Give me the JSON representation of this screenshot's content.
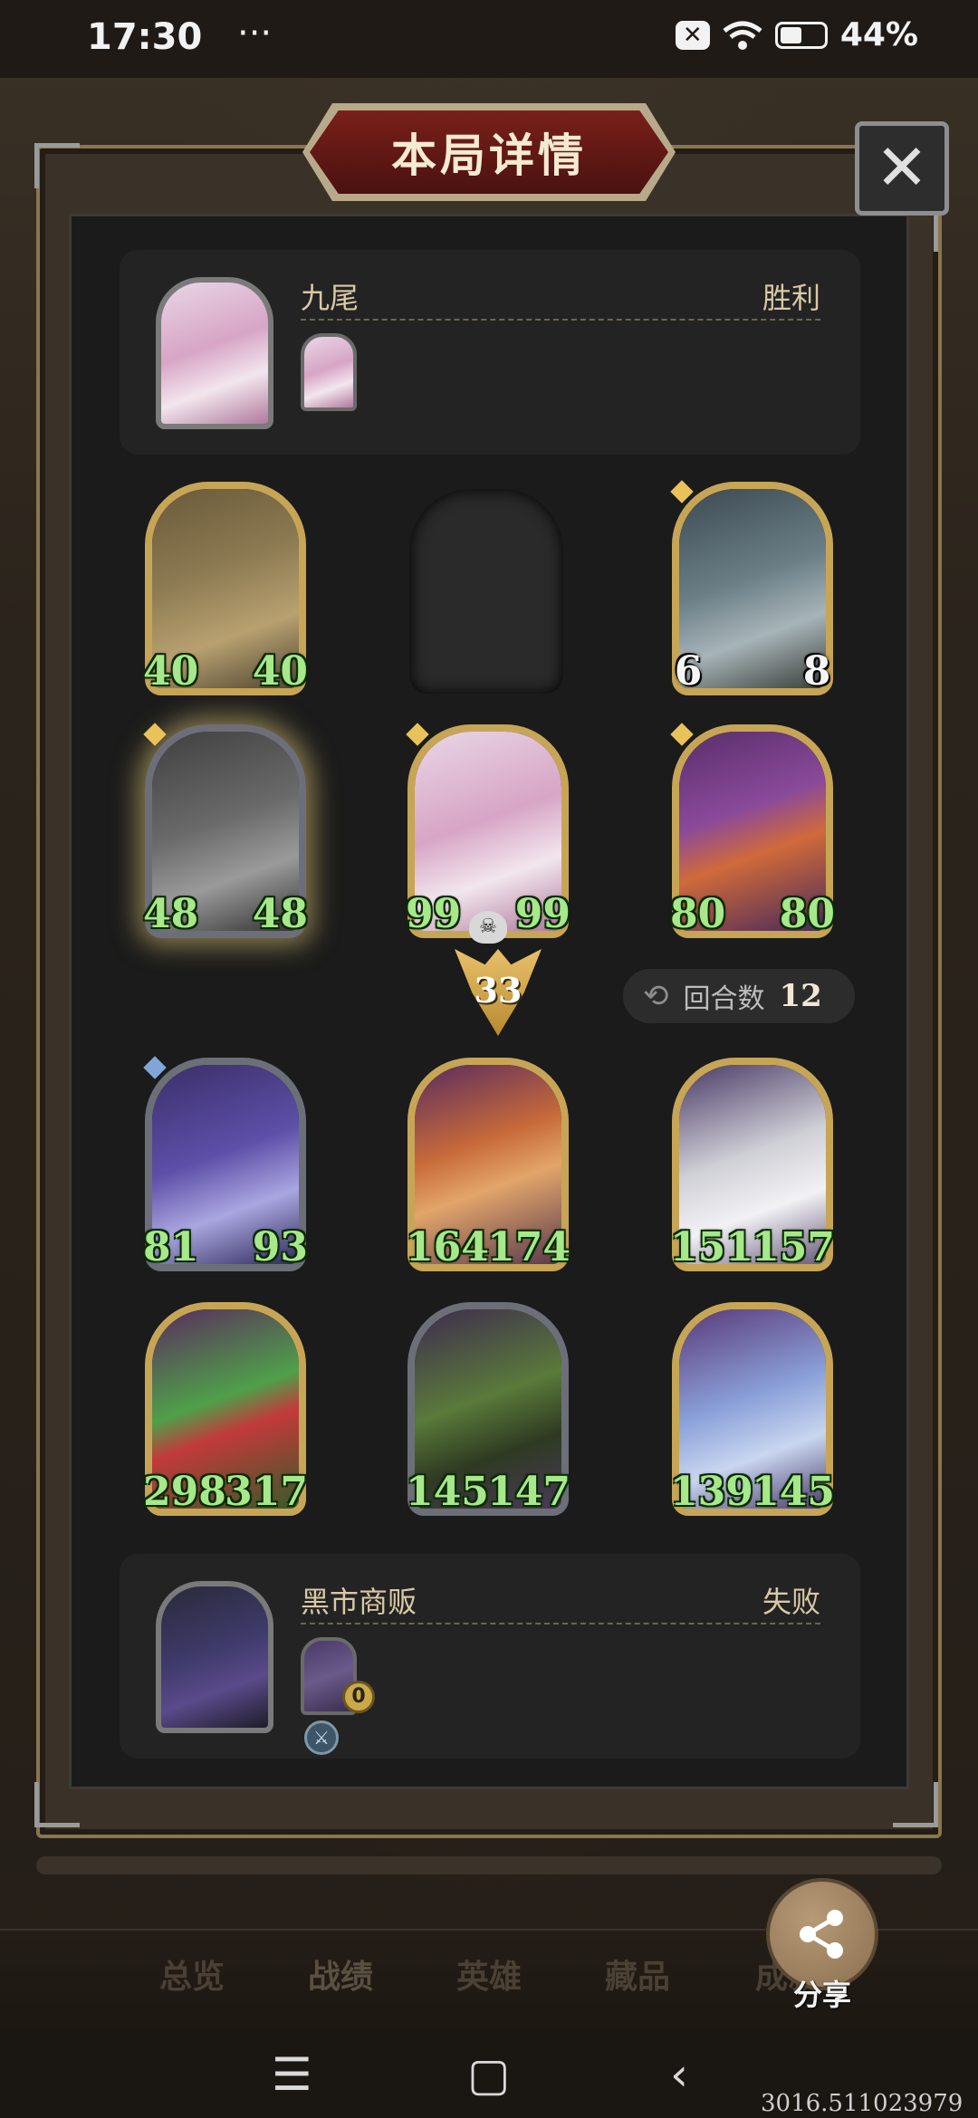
{
  "status_bar": {
    "time": "17:30",
    "more": "···",
    "battery": "44%"
  },
  "modal": {
    "title": "本局详情",
    "close_icon": "✕"
  },
  "top_player": {
    "name": "九尾",
    "result": "胜利"
  },
  "bottom_player": {
    "name": "黑市商贩",
    "result": "失败",
    "coin": "0"
  },
  "top_units": [
    {
      "atk": "40",
      "hp": "40",
      "art": "linear-gradient(160deg,#6b5a3a,#8c7a52 40%,#b8a070 70%,#4e4532)"
    },
    {
      "atk": "6",
      "hp": "8",
      "art": "linear-gradient(160deg,#3d4a52,#6a7e86 45%,#a7b4b8 70%,#3a3f3a)"
    },
    {
      "atk": "48",
      "hp": "48",
      "art": "linear-gradient(160deg,#404040,#6a6a6a 45%,#9a9a9a 70%,#333)"
    },
    {
      "atk": "99",
      "hp": "99",
      "art": "linear-gradient(160deg,#e9d6e6,#d7a5c5 45%,#f2e6ee 70%,#b07a9c)"
    },
    {
      "atk": "80",
      "hp": "80",
      "art": "linear-gradient(160deg,#5a2e6a,#8a4a9a 40%,#d06a3a 60%,#4a2a5a)"
    }
  ],
  "damage": "33",
  "round": {
    "label": "回合数",
    "value": "12"
  },
  "bottom_units": [
    {
      "atk": "81",
      "hp": "93",
      "art": "linear-gradient(160deg,#3a2f6a,#5e4fa8 45%,#a9a6e0 70%,#2e2a5a)"
    },
    {
      "atk": "164",
      "hp": "174",
      "art": "linear-gradient(160deg,#5a2c5e,#c86a3a 40%,#e2a56a 60%,#5a3a4e)"
    },
    {
      "atk": "151",
      "hp": "157",
      "art": "linear-gradient(160deg,#4a3a66,#cfcfd6 45%,#f2f2f5 70%,#6a5a7a)"
    },
    {
      "atk": "298",
      "hp": "317",
      "art": "linear-gradient(160deg,#5a2c5e,#4fa04a 45%,#c23a3a 60%,#3a5a2a)"
    },
    {
      "atk": "145",
      "hp": "147",
      "art": "linear-gradient(160deg,#3e2c4e,#5a7a3a 45%,#2e3a22 70%,#4a3a5a)"
    },
    {
      "atk": "139",
      "hp": "145",
      "art": "linear-gradient(160deg,#5a3a7a,#8aa0d8 45%,#c9d6f0 70%,#4a3a6a)"
    }
  ],
  "nav": [
    {
      "label": "总览"
    },
    {
      "label": "战绩"
    },
    {
      "label": "英雄"
    },
    {
      "label": "藏品"
    },
    {
      "label": "成就"
    }
  ],
  "share": {
    "label": "分享"
  },
  "watermark": "3016.511023979",
  "colors": {
    "gold_border": "#c7a556",
    "stat_green": "#a6e88a",
    "panel": "#232323"
  }
}
